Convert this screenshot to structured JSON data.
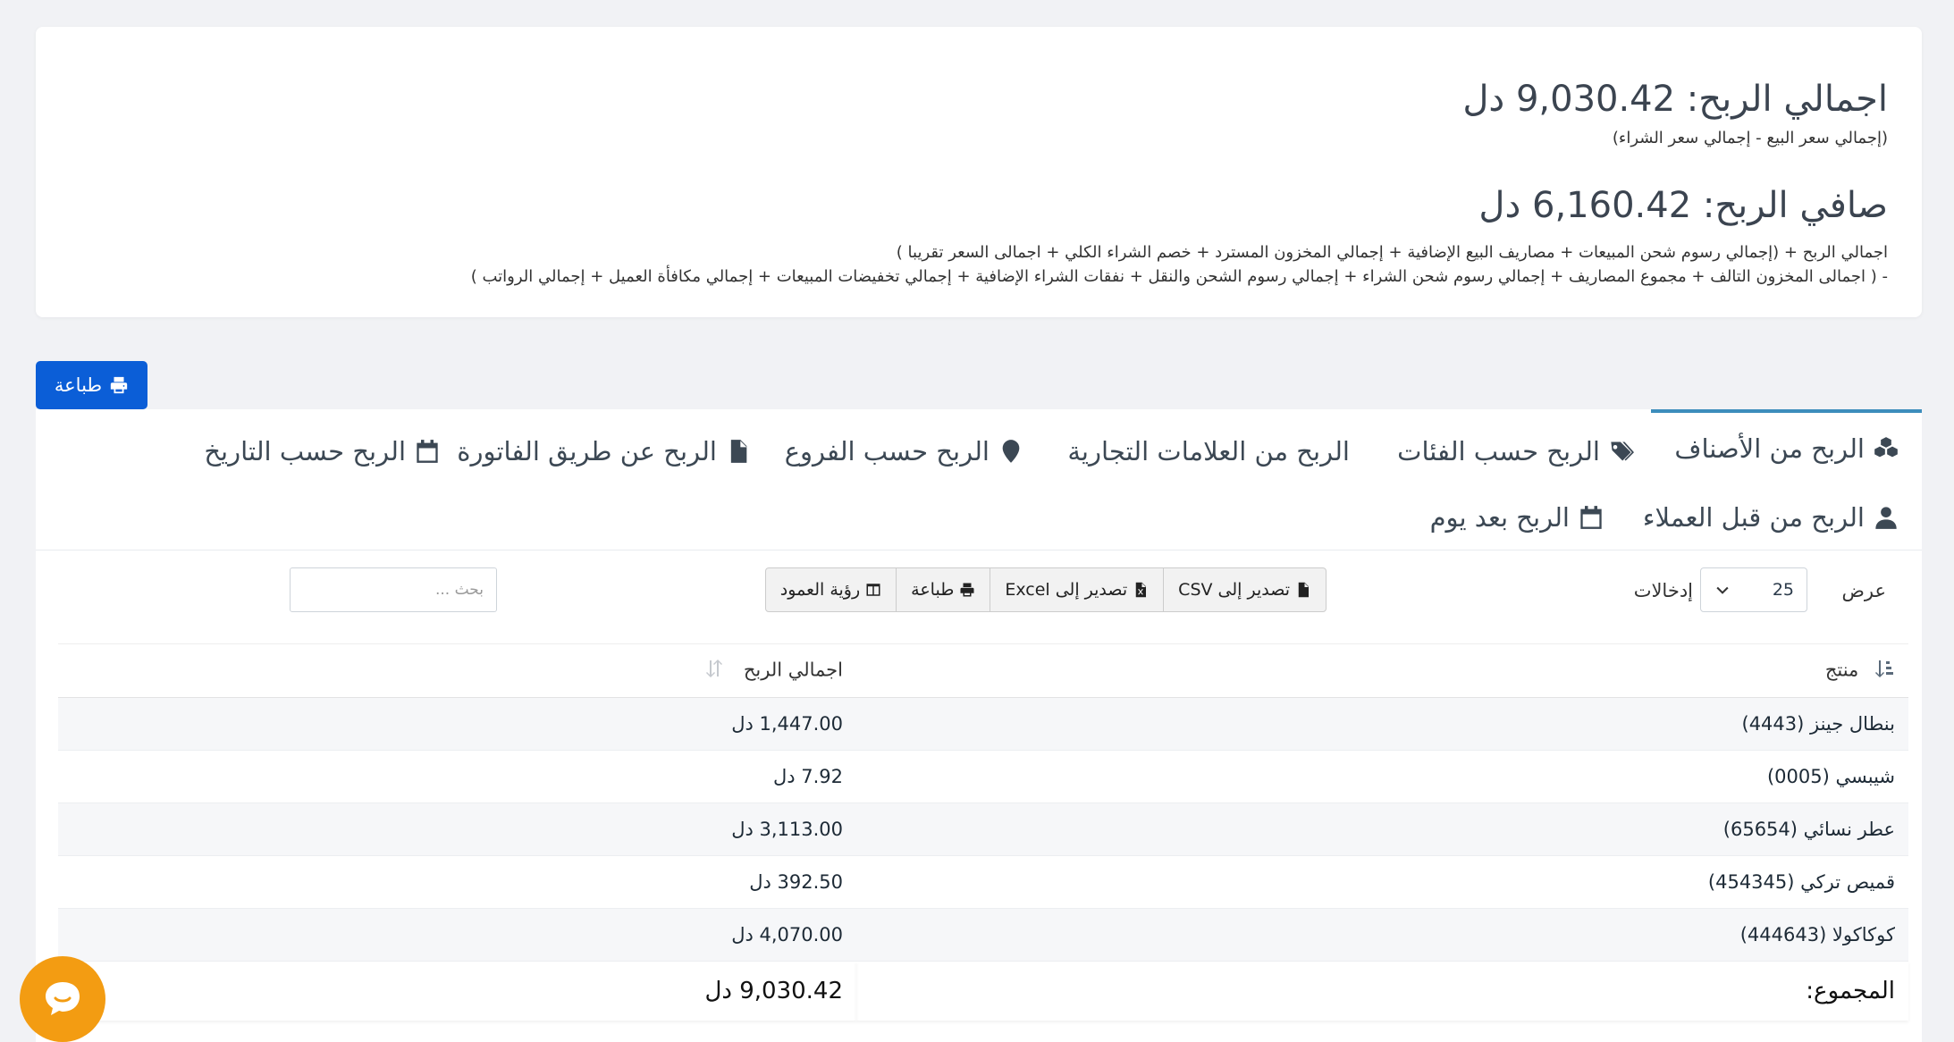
{
  "summary": {
    "gross_label": "اجمالي الربح:",
    "gross_value": "9,030.42",
    "currency": "دل",
    "gross_note": "(إجمالي سعر البيع - إجمالي سعر الشراء)",
    "net_label": "صافي الربح:",
    "net_value": "6,160.42",
    "net_note_line1": "اجمالي الربح + (إجمالي رسوم شحن المبيعات + مصاريف البيع الإضافية + إجمالي المخزون المسترد + خصم الشراء الكلي + اجمالى السعر تقريبا )",
    "net_note_line2": "- ( اجمالى المخزون التالف + مجموع المصاريف + إجمالي رسوم شحن الشراء + إجمالي رسوم الشحن والنقل + نفقات الشراء الإضافية + إجمالي تخفيضات المبيعات + إجمالي مكافأة العميل + إجمالي الرواتب )"
  },
  "print_button": "طباعة",
  "tabs": [
    {
      "label": "الربح من الأصناف",
      "icon": "cubes-icon"
    },
    {
      "label": "الربح حسب الفئات",
      "icon": "tags-icon"
    },
    {
      "label": "الربح من العلامات التجارية",
      "icon": ""
    },
    {
      "label": "الربح حسب الفروع",
      "icon": "map-marker-icon"
    },
    {
      "label": "الربح عن طريق الفاتورة",
      "icon": "file-icon"
    },
    {
      "label": "الربح حسب التاريخ",
      "icon": "calendar-icon"
    },
    {
      "label": "الربح من قبل العملاء",
      "icon": "user-icon"
    },
    {
      "label": "الربح بعد يوم",
      "icon": "calendar-icon"
    }
  ],
  "length_menu": {
    "show": "عرض",
    "value": "25",
    "entries": "إدخالات"
  },
  "export_buttons": {
    "csv": "تصدير إلى CSV",
    "excel": "تصدير إلى Excel",
    "print": "طباعة",
    "colvis": "رؤية العمود"
  },
  "search": {
    "placeholder": "بحث ..."
  },
  "table": {
    "headers": {
      "product": "منتج",
      "gross_profit": "اجمالي الربح"
    },
    "rows": [
      {
        "product": "بنطال جينز (4443)",
        "profit": "1,447.00 دل"
      },
      {
        "product": "شيبسي (0005)",
        "profit": "7.92 دل"
      },
      {
        "product": "عطر نسائي (65654)",
        "profit": "3,113.00 دل"
      },
      {
        "product": "قميص تركي (454345)",
        "profit": "392.50 دل"
      },
      {
        "product": "كوكاكولا (444643)",
        "profit": "4,070.00 دل"
      }
    ],
    "footer": {
      "label": "المجموع:",
      "total": "9,030.42 دل"
    }
  }
}
